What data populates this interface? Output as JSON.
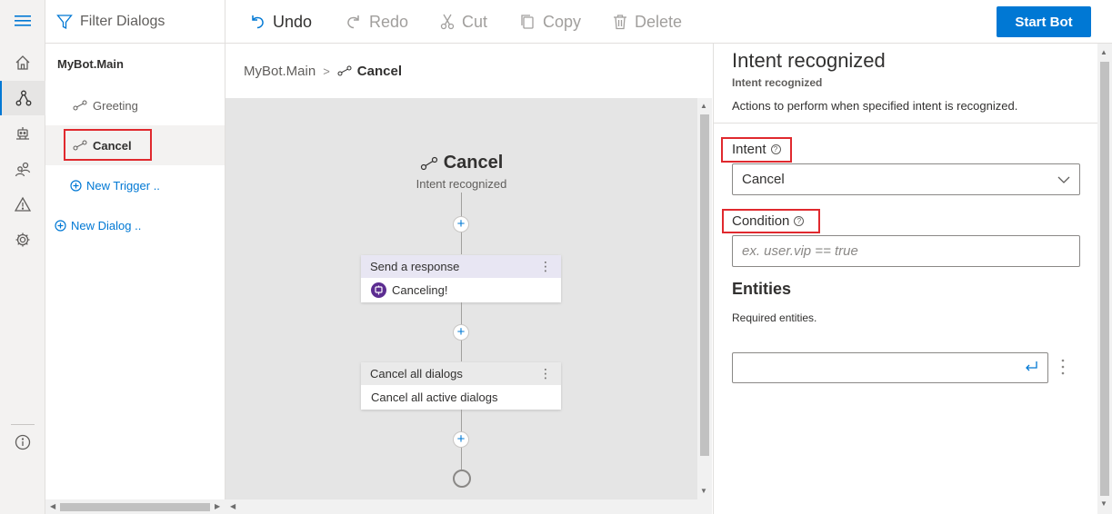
{
  "rail": {
    "items": [
      {
        "icon": "hamburger-icon"
      },
      {
        "icon": "home-icon"
      },
      {
        "icon": "design-flow-icon"
      },
      {
        "icon": "bot-responses-icon"
      },
      {
        "icon": "user-input-icon"
      },
      {
        "icon": "warning-icon"
      },
      {
        "icon": "settings-icon"
      },
      {
        "icon": "info-icon"
      }
    ],
    "active_index": 2,
    "accent": "#0078d4"
  },
  "tree": {
    "filter_label": "Filter Dialogs",
    "dialog": "MyBot.Main",
    "triggers": [
      {
        "label": "Greeting",
        "selected": false
      },
      {
        "label": "Cancel",
        "selected": true
      }
    ],
    "new_trigger": "New Trigger ..",
    "new_dialog": "New Dialog .."
  },
  "toolbar": {
    "undo": "Undo",
    "redo": "Redo",
    "cut": "Cut",
    "copy": "Copy",
    "delete": "Delete",
    "start_bot": "Start Bot"
  },
  "breadcrumb": {
    "root": "MyBot.Main",
    "current": "Cancel"
  },
  "canvas": {
    "trigger_title": "Cancel",
    "trigger_subtitle": "Intent recognized",
    "actions": [
      {
        "header": "Send a response",
        "body": "Canceling!"
      },
      {
        "header": "Cancel all dialogs",
        "body": "Cancel all active dialogs"
      }
    ]
  },
  "props": {
    "title": "Intent recognized",
    "subtitle": "Intent recognized",
    "description": "Actions to perform when specified intent is recognized.",
    "intent_label": "Intent",
    "intent_value": "Cancel",
    "condition_label": "Condition",
    "condition_placeholder": "ex. user.vip == true",
    "entities_title": "Entities",
    "entities_desc": "Required entities.",
    "highlight_color": "#e0292e"
  }
}
